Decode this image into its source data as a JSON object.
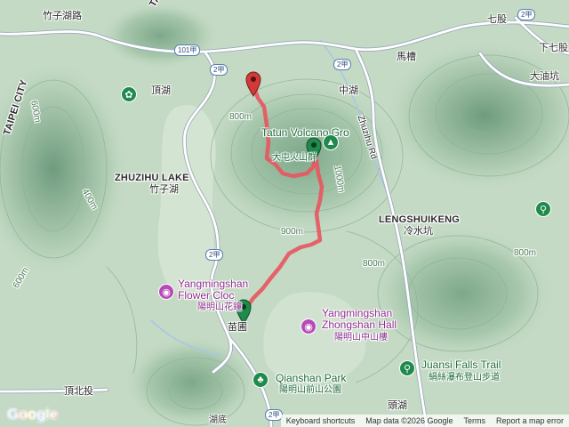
{
  "map": {
    "labels": {
      "zhuzihu_road": "竹子湖路",
      "taipei_city": "TAIPEI CITY",
      "dinghu": "頂湖",
      "zhongshan_top": "中湖",
      "macao": "馬槽",
      "qigu": "七股",
      "xiaqigu": "下七股",
      "dayoukeng": "大油坑",
      "tatun_en": "Tatun Volcano Gro",
      "tatun_zh": "大屯火山群",
      "zhuzihu_en": "ZHUZIHU LAKE",
      "zhuzihu_zh": "竹子湖",
      "lengshuikeng_en": "LENGSHUIKENG",
      "lengshuikeng_zh": "冷水坑",
      "zhuzihu_rd": "Zhuzihu Rd",
      "flower_en1": "Yangmingshan",
      "flower_en2": "Flower Cloc",
      "flower_zh": "陽明山花鐘",
      "miaopu": "苗圃",
      "zhongshan_en1": "Yangmingshan",
      "zhongshan_en2": "Zhongshan Hall",
      "zhongshan_zh": "陽明山中山樓",
      "qianshan_en": "Qianshan Park",
      "qianshan_zh": "陽明山前山公園",
      "juansi_en": "Juansi Falls Trail",
      "juansi_zh": "絹絲瀑布登山步道",
      "dingbeitou": "頂北投",
      "touhu": "頭湖",
      "hupi": "湖底",
      "tai_frag": "TAI"
    },
    "contours": {
      "c800a": "800m",
      "c800b": "800m",
      "c800c": "800m",
      "c900": "900m",
      "c1000": "1000m",
      "c600a": "600m",
      "c600b": "600m",
      "c400": "400m"
    },
    "shields": {
      "r101": "101甲",
      "r2a": "2甲",
      "r2b": "2甲",
      "r2c": "2甲",
      "r2d": "2甲",
      "r2e": "2甲"
    },
    "markers": {
      "start_color": "#1f8a4c",
      "end_color": "#d23a3a",
      "track_color": "#e8555f"
    }
  },
  "footer": {
    "logo": "Google",
    "shortcuts": "Keyboard shortcuts",
    "mapdata": "Map data ©2026 Google",
    "terms": "Terms",
    "report": "Report a map error"
  }
}
